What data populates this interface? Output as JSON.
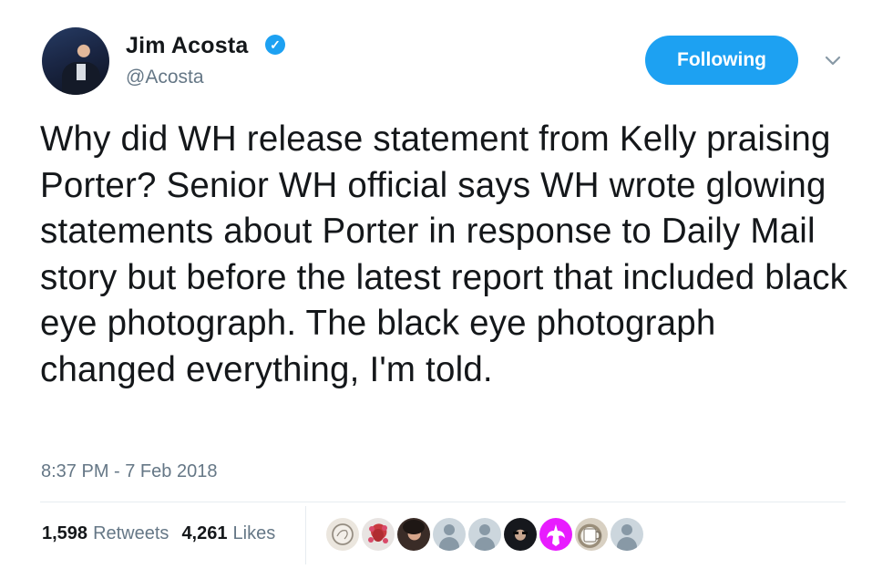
{
  "tweet": {
    "author": {
      "name": "Jim Acosta",
      "handle": "@Acosta",
      "verified": true
    },
    "follow_button_label": "Following",
    "text": "Why did WH release statement from Kelly praising Porter? Senior WH official says WH wrote glowing statements about Porter in response to Daily Mail story but before the latest report that included black eye photograph. The black eye photograph changed everything, I'm told.",
    "timestamp": "8:37 PM - 7 Feb 2018",
    "retweets": {
      "count": "1,598",
      "label": "Retweets"
    },
    "likes": {
      "count": "4,261",
      "label": "Likes"
    }
  },
  "colors": {
    "accent": "#1da1f2",
    "muted": "#657786",
    "text": "#14171a",
    "rebel": "#e81cff"
  },
  "likers": [
    {
      "icon": "profile-photo"
    },
    {
      "icon": "profile-photo"
    },
    {
      "icon": "profile-photo"
    },
    {
      "icon": "default-avatar"
    },
    {
      "icon": "default-avatar"
    },
    {
      "icon": "profile-photo"
    },
    {
      "icon": "rebel-alliance-icon"
    },
    {
      "icon": "profile-photo"
    },
    {
      "icon": "default-avatar"
    }
  ]
}
